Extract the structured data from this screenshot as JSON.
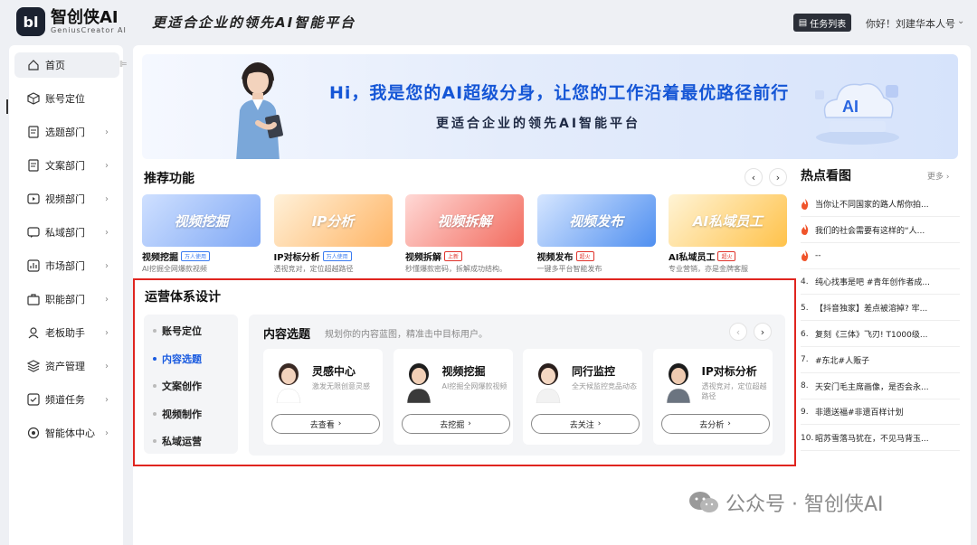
{
  "header": {
    "logo_mark": "bl",
    "logo_name": "智创侠AI",
    "logo_en": "GeniusCreator AI",
    "slogan": "更适合企业的领先AI智能平台",
    "task_button": "任务列表",
    "greeting": "你好！刘建华本人号"
  },
  "sidebar": {
    "items": [
      {
        "label": "首页",
        "icon": "home-icon",
        "chevron": false
      },
      {
        "label": "账号定位",
        "icon": "cube-icon",
        "chevron": false
      },
      {
        "label": "选题部门",
        "icon": "doc-icon",
        "chevron": true
      },
      {
        "label": "文案部门",
        "icon": "doc-icon",
        "chevron": true
      },
      {
        "label": "视频部门",
        "icon": "video-icon",
        "chevron": true
      },
      {
        "label": "私域部门",
        "icon": "chat-icon",
        "chevron": true
      },
      {
        "label": "市场部门",
        "icon": "chart-icon",
        "chevron": true
      },
      {
        "label": "职能部门",
        "icon": "briefcase-icon",
        "chevron": true
      },
      {
        "label": "老板助手",
        "icon": "assistant-icon",
        "chevron": true
      },
      {
        "label": "资产管理",
        "icon": "asset-icon",
        "chevron": true
      },
      {
        "label": "频道任务",
        "icon": "task-icon",
        "chevron": true
      },
      {
        "label": "智能体中心",
        "icon": "agent-icon",
        "chevron": true
      }
    ]
  },
  "banner": {
    "title": "Hi，我是您的AI超级分身，让您的工作沿着最优路径前行",
    "subtitle": "更适合企业的领先AI智能平台",
    "badge": "AI"
  },
  "recommend": {
    "title": "推荐功能",
    "items": [
      {
        "img_text": "视频挖掘",
        "name": "视频挖掘",
        "tag": "万人使用",
        "desc": "AI挖掘全网爆款视频",
        "tag_color": "#3a7bf0"
      },
      {
        "img_text": "IP分析",
        "name": "IP对标分析",
        "tag": "万人使用",
        "desc": "透视竞对，定位超越路径",
        "tag_color": "#3a7bf0"
      },
      {
        "img_text": "视频拆解",
        "name": "视频拆解",
        "tag": "上新",
        "desc": "秒懂爆款密码，拆解成功结构。",
        "tag_color": "#e0332b"
      },
      {
        "img_text": "视频发布",
        "name": "视频发布",
        "tag": "超火",
        "desc": "一键多平台智能发布",
        "tag_color": "#e0332b"
      },
      {
        "img_text": "AI私域员工",
        "name": "AI私域员工",
        "tag": "超火",
        "desc": "专业营销，亦是金牌客服",
        "tag_color": "#e0332b"
      }
    ]
  },
  "hot": {
    "title": "热点看图",
    "more": "更多",
    "items": [
      {
        "rank": "",
        "fire": true,
        "text": "当你让不同国家的路人帮你拍..."
      },
      {
        "rank": "",
        "fire": true,
        "text": "我们的社会需要有这样的“人..."
      },
      {
        "rank": "",
        "fire": true,
        "text": "--"
      },
      {
        "rank": "4.",
        "fire": false,
        "text": "纯心找事是吧 #青年创作者成..."
      },
      {
        "rank": "5.",
        "fire": false,
        "text": "【抖音独家】差点被溶掉? 牢..."
      },
      {
        "rank": "6.",
        "fire": false,
        "text": "复刻《三体》飞刃! T1000级..."
      },
      {
        "rank": "7.",
        "fire": false,
        "text": "#东北#人贩子"
      },
      {
        "rank": "8.",
        "fire": false,
        "text": "天安门毛主席画像，是否会永..."
      },
      {
        "rank": "9.",
        "fire": false,
        "text": "非遗送福#非遗百样计划"
      },
      {
        "rank": "10.",
        "fire": false,
        "text": "昭苏雪落马犹在，不见马背玉..."
      }
    ]
  },
  "ops": {
    "title": "运营体系设计",
    "menu": [
      "账号定位",
      "内容选题",
      "文案创作",
      "视频制作",
      "私域运营"
    ],
    "active_index": 1,
    "panel_title": "内容选题",
    "panel_sub": "规划你的内容蓝图，精准击中目标用户。",
    "cards": [
      {
        "name": "灵感中心",
        "desc": "激发无限创意灵感",
        "button": "去查看",
        "avatar": "woman-avatar"
      },
      {
        "name": "视频挖掘",
        "desc": "AI挖掘全网爆款视频",
        "button": "去挖掘",
        "avatar": "man-avatar"
      },
      {
        "name": "同行监控",
        "desc": "全天候监控竞品动态",
        "button": "去关注",
        "avatar": "girl-avatar"
      },
      {
        "name": "IP对标分析",
        "desc": "透视竞对，定位超越路径",
        "button": "去分析",
        "avatar": "man2-avatar"
      }
    ]
  },
  "watermark": "公众号 · 智创侠AI"
}
